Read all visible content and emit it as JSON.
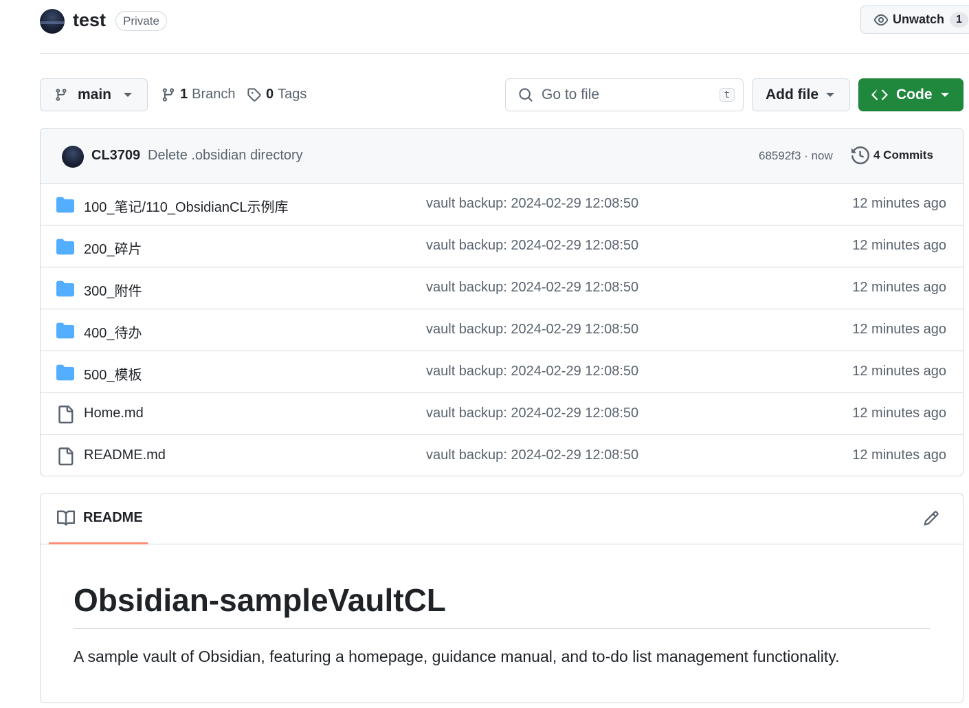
{
  "header": {
    "repo_name": "test",
    "visibility": "Private",
    "watch_label": "Unwatch",
    "watch_count": "1"
  },
  "toolbar": {
    "branch": "main",
    "branch_count": "1",
    "branch_label": "Branch",
    "tag_count": "0",
    "tag_label": "Tags",
    "search_placeholder": "Go to file",
    "search_shortcut": "t",
    "add_file_label": "Add file",
    "code_label": "Code"
  },
  "latest_commit": {
    "author": "CL3709",
    "message": "Delete .obsidian directory",
    "sha_time": "68592f3 · now",
    "commits_label": "4 Commits"
  },
  "files": [
    {
      "type": "folder",
      "name": "100_笔记/110_ObsidianCL示例库",
      "message": "vault backup: 2024-02-29 12:08:50",
      "time": "12 minutes ago"
    },
    {
      "type": "folder",
      "name": "200_碎片",
      "message": "vault backup: 2024-02-29 12:08:50",
      "time": "12 minutes ago"
    },
    {
      "type": "folder",
      "name": "300_附件",
      "message": "vault backup: 2024-02-29 12:08:50",
      "time": "12 minutes ago"
    },
    {
      "type": "folder",
      "name": "400_待办",
      "message": "vault backup: 2024-02-29 12:08:50",
      "time": "12 minutes ago"
    },
    {
      "type": "folder",
      "name": "500_模板",
      "message": "vault backup: 2024-02-29 12:08:50",
      "time": "12 minutes ago"
    },
    {
      "type": "file",
      "name": "Home.md",
      "message": "vault backup: 2024-02-29 12:08:50",
      "time": "12 minutes ago"
    },
    {
      "type": "file",
      "name": "README.md",
      "message": "vault backup: 2024-02-29 12:08:50",
      "time": "12 minutes ago"
    }
  ],
  "readme": {
    "tab_label": "README",
    "title": "Obsidian-sampleVaultCL",
    "description": "A sample vault of Obsidian, featuring a homepage, guidance manual, and to-do list management functionality."
  },
  "colors": {
    "accent_green": "#1f883d",
    "folder_blue": "#54aeff",
    "readme_tab_underline": "#fd8c73",
    "muted_text": "#59636e",
    "border": "#d1d9e0"
  }
}
